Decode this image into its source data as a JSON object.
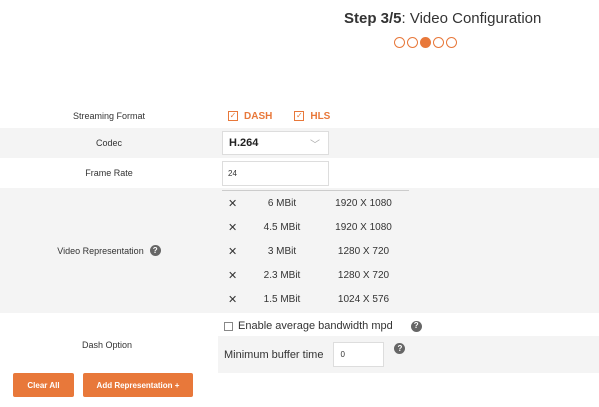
{
  "header": {
    "step_label": "Step 3/5",
    "step_title": ": Video Configuration",
    "steps_total": 5,
    "current_step": 3
  },
  "form": {
    "streaming_format": {
      "label": "Streaming Format",
      "options": [
        {
          "label": "DASH",
          "checked": true
        },
        {
          "label": "HLS",
          "checked": true
        }
      ]
    },
    "codec": {
      "label": "Codec",
      "value": "H.264"
    },
    "frame_rate": {
      "label": "Frame Rate",
      "value": "24"
    },
    "video_representation": {
      "label": "Video Representation",
      "rows": [
        {
          "bitrate": "6 MBit",
          "resolution": "1920 X 1080"
        },
        {
          "bitrate": "4.5 MBit",
          "resolution": "1920 X 1080"
        },
        {
          "bitrate": "3 MBit",
          "resolution": "1280 X 720"
        },
        {
          "bitrate": "2.3 MBit",
          "resolution": "1280 X 720"
        },
        {
          "bitrate": "1.5 MBit",
          "resolution": "1024 X 576"
        }
      ],
      "remove_glyph": "✕"
    },
    "dash_option": {
      "label": "Dash Option",
      "avg_bandwidth_label": "Enable average bandwidth mpd",
      "avg_bandwidth_checked": false,
      "min_buffer_label": "Minimum buffer time",
      "min_buffer_value": "0"
    }
  },
  "buttons": {
    "clear_all": "Clear All",
    "add_representation": "Add Representation +"
  },
  "colors": {
    "accent": "#e8783a",
    "shaded_row": "#f4f4f4"
  },
  "icons": {
    "help": "question-circle-icon",
    "check": "checkmark-icon",
    "remove": "x-icon",
    "chevron": "chevron-down-icon"
  }
}
